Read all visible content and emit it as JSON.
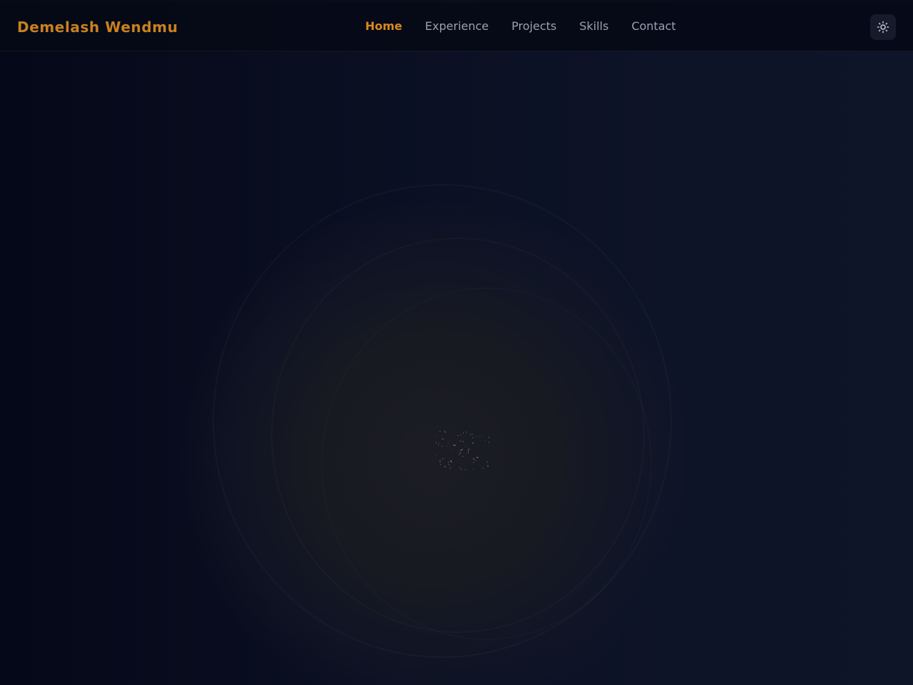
{
  "brand": {
    "name": "Demelash Wendmu"
  },
  "nav": {
    "items": [
      {
        "label": "Home",
        "active": true
      },
      {
        "label": "Experience",
        "active": false
      },
      {
        "label": "Projects",
        "active": false
      },
      {
        "label": "Skills",
        "active": false
      },
      {
        "label": "Contact",
        "active": false
      }
    ]
  },
  "theme_toggle": {
    "icon": "sun-icon"
  },
  "colors": {
    "accent": "#d8891f",
    "brand_text": "#c9811f",
    "nav_text": "#9aa0b0",
    "background": "#070b1a"
  }
}
